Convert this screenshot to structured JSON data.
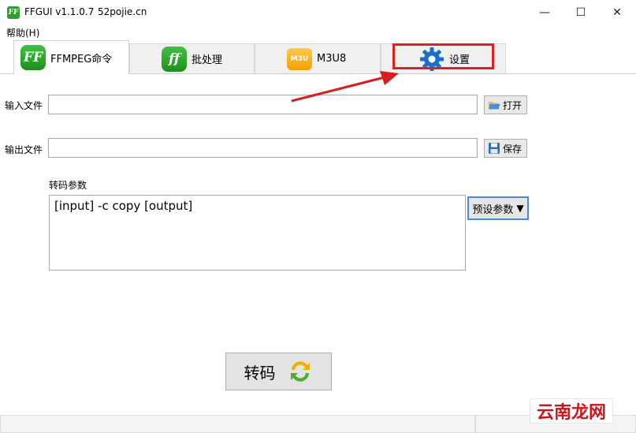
{
  "titlebar": {
    "app_icon_text": "FF",
    "title": "FFGUI v1.1.0.7",
    "site": "52pojie.cn",
    "minimize": "—",
    "maximize": "☐",
    "close": "✕"
  },
  "menu": {
    "help": "帮助(H)"
  },
  "tabs": [
    {
      "label": "FFMPEG命令",
      "icon": "FF",
      "active": true
    },
    {
      "label": "批处理",
      "icon": "ff",
      "active": false
    },
    {
      "label": "M3U8",
      "icon": "M3U",
      "active": false
    },
    {
      "label": "设置",
      "icon": "gear-icon",
      "active": false
    }
  ],
  "form": {
    "input_label": "输入文件",
    "input_value": "",
    "open_button": "打开",
    "output_label": "输出文件",
    "output_value": "",
    "save_button": "保存",
    "params_label": "转码参数",
    "params_value": "[input] -c copy [output]",
    "preset_button": "预设参数",
    "preset_arrow": "▼",
    "convert_button": "转码"
  },
  "watermark": {
    "text": "云南龙网"
  },
  "colors": {
    "highlight": "#e02020",
    "brand_green": "#2e9e2e",
    "m3u_orange": "#f0a000",
    "gear_blue": "#1a6fc9"
  }
}
